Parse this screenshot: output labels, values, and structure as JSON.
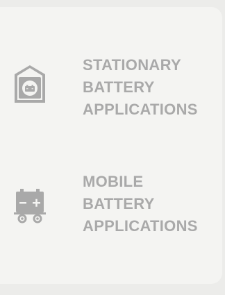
{
  "applications": [
    {
      "id": "stationary",
      "icon": "house-battery-icon",
      "label_lines": [
        "STATIONARY",
        "BATTERY",
        "APPLICATIONS"
      ]
    },
    {
      "id": "mobile",
      "icon": "battery-cart-icon",
      "label_lines": [
        "MOBILE",
        "BATTERY",
        "APPLICATIONS"
      ]
    }
  ],
  "colors": {
    "page_background": "#ececea",
    "panel_background": "#f4f4f2",
    "text": "#a9a9a9",
    "icon": "#a9a9a9"
  }
}
